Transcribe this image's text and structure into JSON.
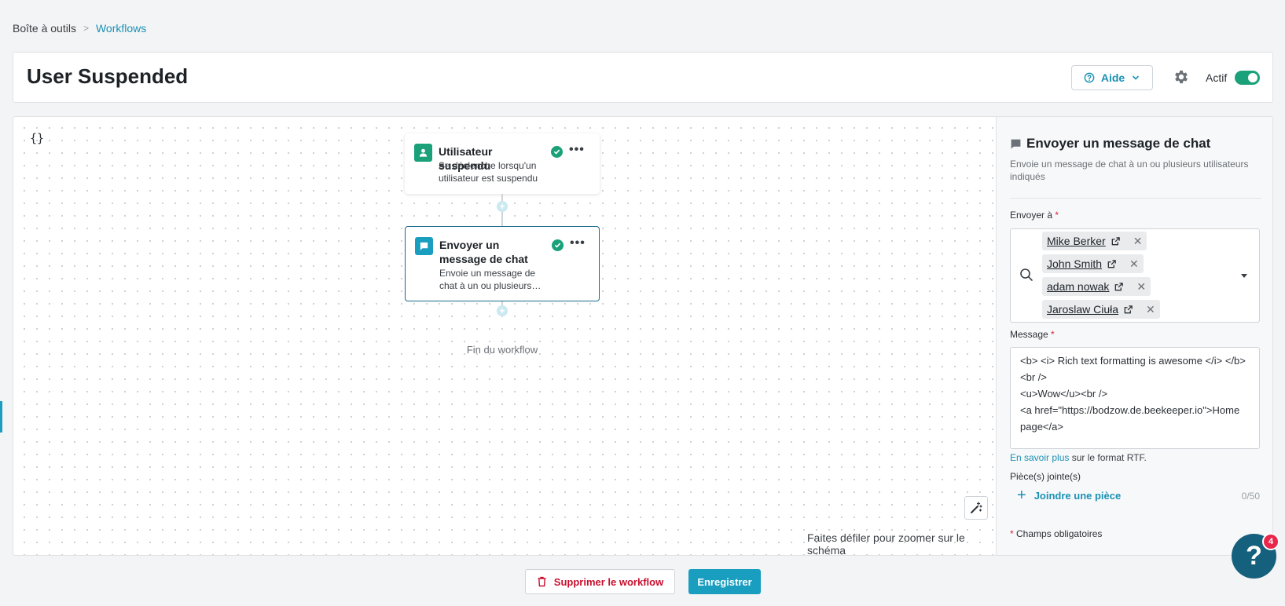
{
  "breadcrumb": {
    "root": "Boîte à outils",
    "separator": ">",
    "current": "Workflows"
  },
  "header": {
    "title": "User Suspended",
    "help_label": "Aide",
    "active_label": "Actif",
    "active": true
  },
  "canvas": {
    "variables_label": "{}",
    "trigger_node": {
      "title": "Utilisateur suspendu",
      "description": "Se déclenche lorsqu'un utilisateur est suspendu",
      "status": "valid",
      "icon": "user-icon"
    },
    "action_node": {
      "title": "Envoyer un message de chat",
      "description": "Envoie un message de chat à un ou plusieurs…",
      "status": "valid",
      "icon": "chat-icon"
    },
    "end_label": "Fin du workflow",
    "zoom_hint": "Faites défiler pour zoomer sur le schéma"
  },
  "panel": {
    "title": "Envoyer un message de chat",
    "description": "Envoie un message de chat à un ou plusieurs utilisateurs indiqués",
    "recipients_label": "Envoyer à",
    "recipients": [
      {
        "name": "Mike Berker"
      },
      {
        "name": "John Smith"
      },
      {
        "name": "adam nowak"
      },
      {
        "name": "Jaroslaw Ciuła"
      }
    ],
    "message_label": "Message",
    "message_value": "<b> <i> Rich text formatting is awesome </i> </b> <br />\n<u>Wow</u><br />\n<a href=\"https://bodzow.de.beekeeper.io\">Home page</a>",
    "rtf_link": "En savoir plus",
    "rtf_text": " sur le format RTF.",
    "attachments_label": "Pièce(s) jointe(s)",
    "attach_button": "Joindre une pièce",
    "attach_count": "0/50",
    "required_asterisk": "*",
    "required_note": " Champs obligatoires"
  },
  "footer": {
    "delete_label": "Supprimer le workflow",
    "save_label": "Enregistrer"
  },
  "help_widget": {
    "badge_count": "4"
  },
  "colors": {
    "accent": "#1a9ec0",
    "success": "#1aa179",
    "danger": "#c8102e",
    "fab": "#15607d"
  }
}
